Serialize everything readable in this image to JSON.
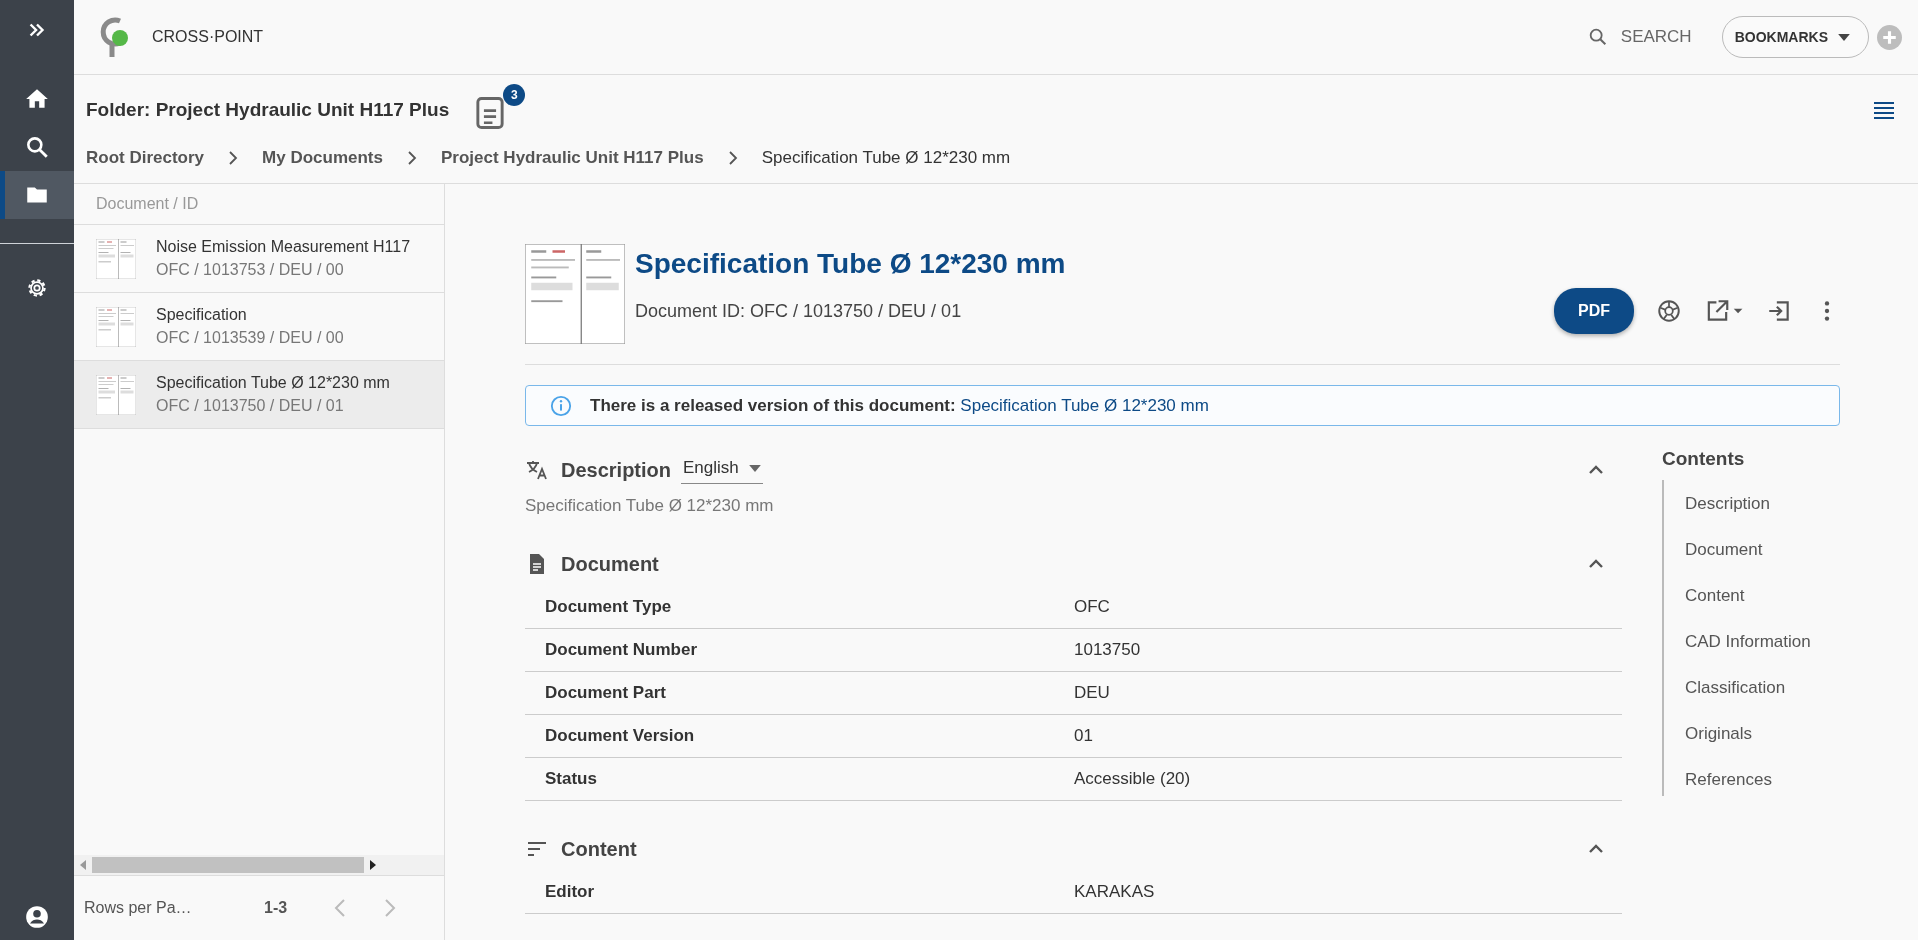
{
  "rail": {
    "items": [
      {
        "kind": "home",
        "selected": false
      },
      {
        "kind": "search",
        "selected": false
      },
      {
        "kind": "folder",
        "selected": true
      },
      {
        "kind": "settings",
        "selected": false
      }
    ]
  },
  "header": {
    "logo_text": "CROSS·POINT",
    "search_label": "SEARCH",
    "bookmarks_label": "BOOKMARKS"
  },
  "folder": {
    "title": "Folder: Project Hydraulic Unit H117 Plus",
    "badge": "3",
    "breadcrumbs": [
      "Root Directory",
      "My Documents",
      "Project Hydraulic Unit H117 Plus",
      "Specification Tube Ø 12*230 mm"
    ]
  },
  "list": {
    "column_header": "Document / ID",
    "rows": [
      {
        "title": "Noise Emission Measurement H117",
        "id": "OFC / 1013753 / DEU / 00",
        "selected": false
      },
      {
        "title": "Specification",
        "id": "OFC / 1013539 / DEU / 00",
        "selected": false
      },
      {
        "title": "Specification Tube Ø 12*230 mm",
        "id": "OFC / 1013750 / DEU / 01",
        "selected": true
      }
    ],
    "pager": {
      "rows_per_page": "Rows per Pa…",
      "range": "1-3"
    }
  },
  "document": {
    "title": "Specification Tube Ø 12*230 mm",
    "id_line": "Document ID: OFC / 1013750 / DEU / 01",
    "pdf_label": "PDF",
    "notice": {
      "text": "There is a released version of this document:",
      "link": "Specification Tube Ø 12*230 mm"
    }
  },
  "sections": [
    {
      "kind": "description",
      "title": "Description",
      "expanded": true,
      "language": "English",
      "text": "Specification Tube Ø 12*230 mm"
    },
    {
      "kind": "document",
      "title": "Document",
      "expanded": true,
      "rows": [
        {
          "label": "Document Type",
          "value": "OFC"
        },
        {
          "label": "Document Number",
          "value": "1013750"
        },
        {
          "label": "Document Part",
          "value": "DEU"
        },
        {
          "label": "Document Version",
          "value": "01"
        },
        {
          "label": "Status",
          "value": "Accessible (20)"
        }
      ]
    },
    {
      "kind": "content",
      "title": "Content",
      "expanded": true,
      "rows": [
        {
          "label": "Editor",
          "value": "KARAKAS"
        }
      ]
    }
  ],
  "contents": {
    "title": "Contents",
    "items": [
      "Description",
      "Document",
      "Content",
      "CAD Information",
      "Classification",
      "Originals",
      "References"
    ]
  }
}
